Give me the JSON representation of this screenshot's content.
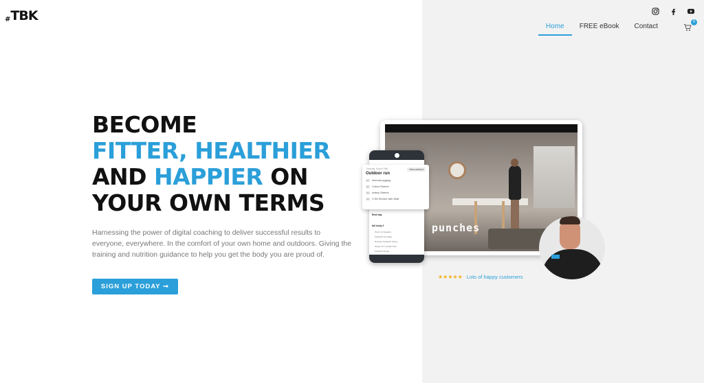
{
  "brand": {
    "logo_hash": "#",
    "logo_text": "TBK"
  },
  "social": [
    {
      "icon": "instagram-icon"
    },
    {
      "icon": "facebook-icon"
    },
    {
      "icon": "youtube-icon"
    }
  ],
  "nav": {
    "items": [
      {
        "label": "Home",
        "active": true
      },
      {
        "label": "FREE eBook",
        "active": false
      },
      {
        "label": "Contact",
        "active": false
      }
    ],
    "cart_count": "0"
  },
  "hero": {
    "line1": "BECOME",
    "line2": "FITTER, HEALTHIER",
    "line3_a": "AND ",
    "line3_b": "HAPPIER",
    "line3_c": " ON",
    "line4": "YOUR OWN TERMS",
    "description": "Harnessing the power of digital coaching to deliver successful results to everyone, everywhere. In the comfort of your own home and outdoors. Giving the training and nutrition guidance to help you get the body you are proud of.",
    "cta_label": "SIGN UP TODAY ➞"
  },
  "mockup": {
    "video_caption": "punches",
    "card": {
      "date": "Tuesday, March 26th",
      "view_label": "View workout",
      "title": "Outdoor run",
      "exercises": [
        {
          "num": "1",
          "name": "Interval jogging"
        },
        {
          "num": "2",
          "name": "Cobra Stretch"
        },
        {
          "num": "3",
          "name": "Instep Stretch"
        },
        {
          "num": "4",
          "name": "V-Sit Stretch with Wall"
        }
      ]
    },
    "phone": {
      "rest_day": "Rest day",
      "full_body": "full body 2",
      "items": [
        "Push Up Negative",
        "Kettlebell Goodday",
        "Russian Kettlebell Swing",
        "Single Arm Upright Row",
        "Kettlebell Squat"
      ]
    }
  },
  "reviews": {
    "stars": "★★★★★",
    "text": "Lots of happy customers"
  },
  "colors": {
    "accent": "#2b9fd9",
    "text": "#111111",
    "muted": "#777777",
    "panel": "#f2f2f2"
  }
}
